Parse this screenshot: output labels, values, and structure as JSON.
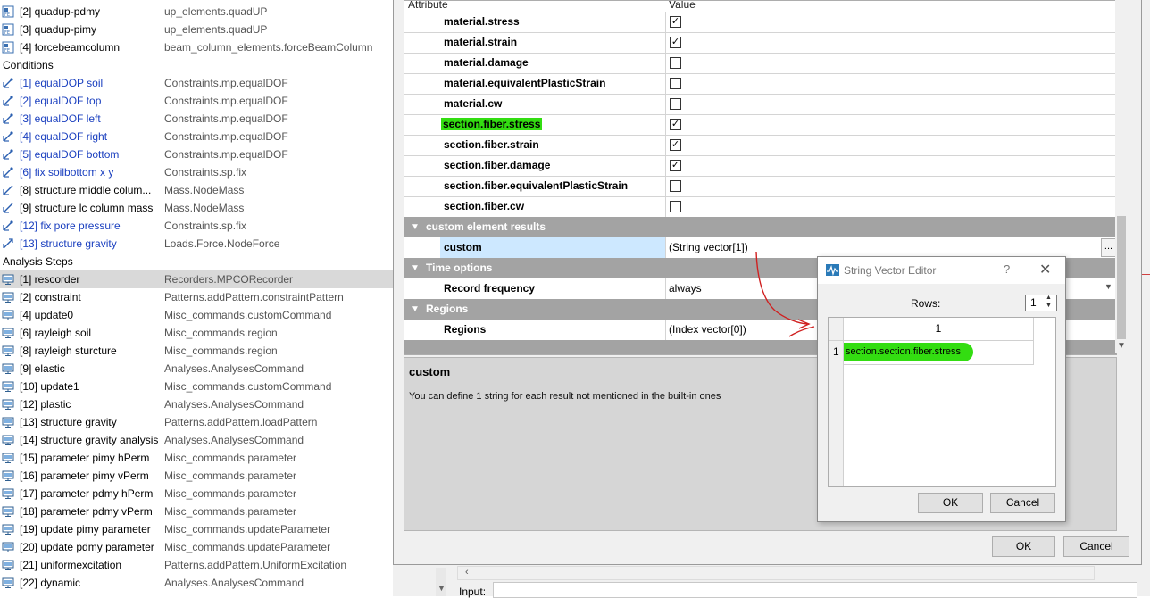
{
  "tree": {
    "rows": [
      {
        "kind": "item",
        "name": "[2] quadup-pdmy",
        "type": "up_elements.quadUP",
        "icon": "element-icon"
      },
      {
        "kind": "item",
        "name": "[3] quadup-pimy",
        "type": "up_elements.quadUP",
        "icon": "element-icon"
      },
      {
        "kind": "item",
        "name": "[4] forcebeamcolumn",
        "type": "beam_column_elements.forceBeamColumn",
        "icon": "element-icon"
      },
      {
        "kind": "group",
        "name": "Conditions",
        "type": "",
        "icon": ""
      },
      {
        "kind": "cond",
        "name": "[1] equalDOP soil",
        "type": "Constraints.mp.equalDOF",
        "icon": "constraint-icon"
      },
      {
        "kind": "cond",
        "name": "[2] equalDOF top",
        "type": "Constraints.mp.equalDOF",
        "icon": "constraint-icon"
      },
      {
        "kind": "cond",
        "name": "[3] equalDOF left",
        "type": "Constraints.mp.equalDOF",
        "icon": "constraint-icon"
      },
      {
        "kind": "cond",
        "name": "[4] equalDOF right",
        "type": "Constraints.mp.equalDOF",
        "icon": "constraint-icon"
      },
      {
        "kind": "cond",
        "name": "[5] equalDOF bottom",
        "type": "Constraints.mp.equalDOF",
        "icon": "constraint-icon"
      },
      {
        "kind": "cond",
        "name": "[6] fix soilbottom x y",
        "type": "Constraints.sp.fix",
        "icon": "constraint-icon"
      },
      {
        "kind": "item",
        "name": "[8] structure middle colum...",
        "type": "Mass.NodeMass",
        "icon": "mass-icon"
      },
      {
        "kind": "item",
        "name": "[9] structure lc column mass",
        "type": "Mass.NodeMass",
        "icon": "mass-icon"
      },
      {
        "kind": "cond",
        "name": "[12] fix pore pressure",
        "type": "Constraints.sp.fix",
        "icon": "constraint-icon"
      },
      {
        "kind": "cond",
        "name": "[13] structure gravity",
        "type": "Loads.Force.NodeForce",
        "icon": "load-icon"
      },
      {
        "kind": "group",
        "name": "Analysis Steps",
        "type": "",
        "icon": ""
      },
      {
        "kind": "sel",
        "name": "[1] rescorder",
        "type": "Recorders.MPCORecorder",
        "icon": "monitor-icon"
      },
      {
        "kind": "item",
        "name": "[2] constraint",
        "type": "Patterns.addPattern.constraintPattern",
        "icon": "monitor-icon"
      },
      {
        "kind": "item",
        "name": "[4] update0",
        "type": "Misc_commands.customCommand",
        "icon": "monitor-icon"
      },
      {
        "kind": "item",
        "name": "[6] rayleigh soil",
        "type": "Misc_commands.region",
        "icon": "monitor-icon"
      },
      {
        "kind": "item",
        "name": "[8] rayleigh sturcture",
        "type": "Misc_commands.region",
        "icon": "monitor-icon"
      },
      {
        "kind": "item",
        "name": "[9] elastic",
        "type": "Analyses.AnalysesCommand",
        "icon": "monitor-icon"
      },
      {
        "kind": "item",
        "name": "[10] update1",
        "type": "Misc_commands.customCommand",
        "icon": "monitor-icon"
      },
      {
        "kind": "item",
        "name": "[12] plastic",
        "type": "Analyses.AnalysesCommand",
        "icon": "monitor-icon"
      },
      {
        "kind": "item",
        "name": "[13] structure gravity",
        "type": "Patterns.addPattern.loadPattern",
        "icon": "monitor-icon"
      },
      {
        "kind": "item",
        "name": "[14] structure gravity analysis",
        "type": "Analyses.AnalysesCommand",
        "icon": "monitor-icon"
      },
      {
        "kind": "item",
        "name": "[15] parameter pimy hPerm",
        "type": "Misc_commands.parameter",
        "icon": "monitor-icon"
      },
      {
        "kind": "item",
        "name": "[16] parameter pimy vPerm",
        "type": "Misc_commands.parameter",
        "icon": "monitor-icon"
      },
      {
        "kind": "item",
        "name": "[17] parameter pdmy hPerm",
        "type": "Misc_commands.parameter",
        "icon": "monitor-icon"
      },
      {
        "kind": "item",
        "name": "[18] parameter pdmy vPerm",
        "type": "Misc_commands.parameter",
        "icon": "monitor-icon"
      },
      {
        "kind": "item",
        "name": "[19] update pimy parameter",
        "type": "Misc_commands.updateParameter",
        "icon": "monitor-icon"
      },
      {
        "kind": "item",
        "name": "[20] update pdmy parameter",
        "type": "Misc_commands.updateParameter",
        "icon": "monitor-icon"
      },
      {
        "kind": "item",
        "name": "[21] uniformexcitation",
        "type": "Patterns.addPattern.UniformExcitation",
        "icon": "monitor-icon"
      },
      {
        "kind": "item",
        "name": "[22] dynamic",
        "type": "Analyses.AnalysesCommand",
        "icon": "monitor-icon"
      }
    ]
  },
  "grid": {
    "header_attribute": "Attribute",
    "header_value": "Value",
    "checkbox_rows": [
      {
        "key": "material.stress",
        "checked": true,
        "highlight": false
      },
      {
        "key": "material.strain",
        "checked": true,
        "highlight": false
      },
      {
        "key": "material.damage",
        "checked": false,
        "highlight": false
      },
      {
        "key": "material.equivalentPlasticStrain",
        "checked": false,
        "highlight": false
      },
      {
        "key": "material.cw",
        "checked": false,
        "highlight": false
      },
      {
        "key": "section.fiber.stress",
        "checked": true,
        "highlight": true
      },
      {
        "key": "section.fiber.strain",
        "checked": true,
        "highlight": false
      },
      {
        "key": "section.fiber.damage",
        "checked": true,
        "highlight": false
      },
      {
        "key": "section.fiber.equivalentPlasticStrain",
        "checked": false,
        "highlight": false
      },
      {
        "key": "section.fiber.cw",
        "checked": false,
        "highlight": false
      }
    ],
    "section_custom": "custom element results",
    "custom_key": "custom",
    "custom_value": "(String vector[1])",
    "ellipsis": "...",
    "section_time": "Time options",
    "record_frequency_key": "Record frequency",
    "record_frequency_value": "always",
    "section_regions": "Regions",
    "regions_key": "Regions",
    "regions_value": "(Index vector[0])"
  },
  "description": {
    "title": "custom",
    "text": "You can define 1 string for each result not mentioned in the built-in ones"
  },
  "dialog_buttons": {
    "ok": "OK",
    "cancel": "Cancel"
  },
  "bottom_panel": {
    "input_label": "Input:"
  },
  "string_vector_editor": {
    "title": "String Vector Editor",
    "help": "?",
    "close": "✕",
    "rows_label": "Rows:",
    "rows_value": "1",
    "column_header": "1",
    "row_header": "1",
    "cell_value": "section.section.fiber.stress",
    "ok": "OK",
    "cancel": "Cancel"
  },
  "colors": {
    "highlight": "#33dd11",
    "section_bg": "#a3a3a3",
    "link_blue": "#1a3fbf",
    "annotation_red": "#d02020"
  }
}
